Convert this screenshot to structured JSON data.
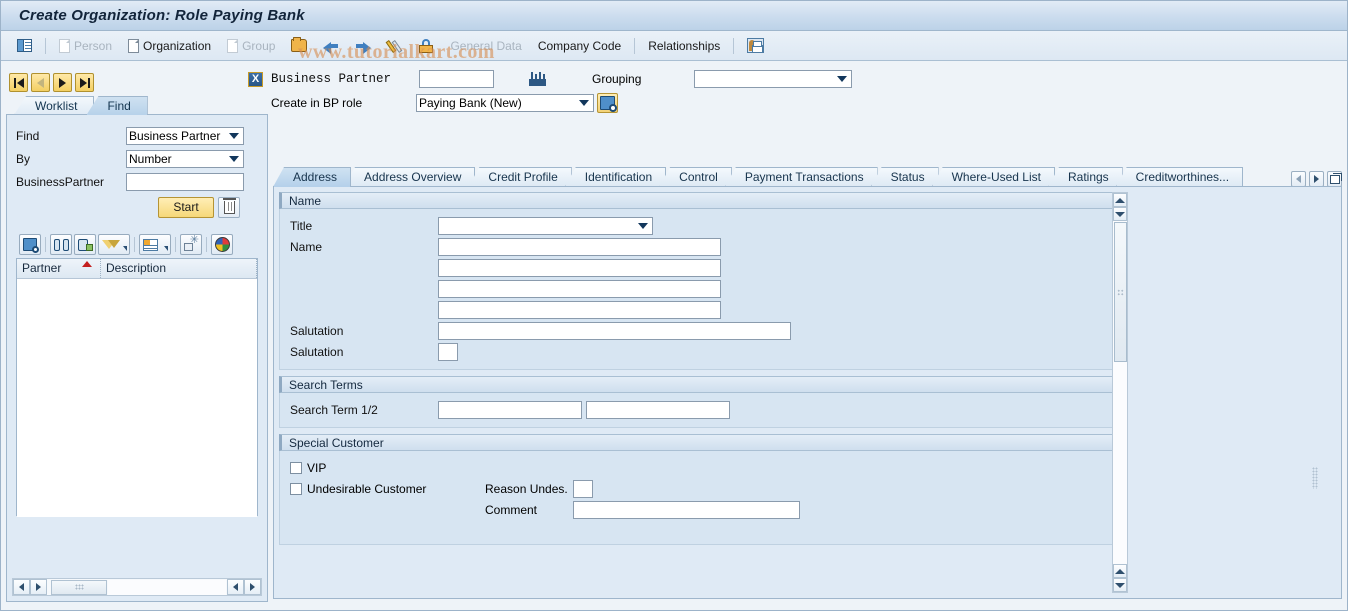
{
  "window": {
    "title": "Create Organization: Role Paying Bank"
  },
  "watermark": {
    "text": "www.tutorialkart.com",
    "ring_glyph": "c"
  },
  "toolbar": {
    "items": [
      {
        "name": "worklist-toggle",
        "label": "",
        "icon": "list-icon",
        "enabled": true
      },
      {
        "name": "person",
        "label": "Person",
        "icon": "page-icon",
        "enabled": false
      },
      {
        "name": "organization",
        "label": "Organization",
        "icon": "page-icon",
        "enabled": true
      },
      {
        "name": "group",
        "label": "Group",
        "icon": "page-icon",
        "enabled": false
      },
      {
        "name": "open-folder",
        "label": "",
        "icon": "open-folder-icon",
        "enabled": true
      },
      {
        "name": "back",
        "label": "",
        "icon": "arrow-left-icon",
        "enabled": true
      },
      {
        "name": "forward",
        "label": "",
        "icon": "arrow-right-icon",
        "enabled": true
      },
      {
        "name": "change",
        "label": "",
        "icon": "pencil-icon",
        "enabled": true
      },
      {
        "name": "display",
        "label": "",
        "icon": "lock-icon",
        "enabled": true
      },
      {
        "name": "general-data",
        "label": "General Data",
        "enabled": false
      },
      {
        "name": "company-code",
        "label": "Company Code",
        "enabled": true
      },
      {
        "name": "relationships",
        "label": "Relationships",
        "enabled": true
      },
      {
        "name": "relationship-bp",
        "label": "",
        "icon": "relationship-bp-icon",
        "enabled": true
      }
    ]
  },
  "navigation": {
    "first_label": "First",
    "prev_label": "Previous",
    "next_label": "Next",
    "last_label": "Last"
  },
  "left_panel": {
    "tabs": [
      {
        "label": "Worklist",
        "active": false
      },
      {
        "label": "Find",
        "active": true
      }
    ],
    "find": {
      "find_label": "Find",
      "find_value": "Business Partner",
      "by_label": "By",
      "by_value": "Number",
      "partner_label": "BusinessPartner",
      "partner_value": "",
      "start_label": "Start",
      "delete_label": "Delete"
    },
    "alv_toolbar": [
      {
        "name": "detail",
        "icon": "magnifier-icon"
      },
      {
        "name": "find",
        "icon": "binoculars-icon"
      },
      {
        "name": "find-next",
        "icon": "binoculars-next-icon"
      },
      {
        "name": "filter",
        "icon": "funnel-icon",
        "dropdown": true
      },
      {
        "name": "layout",
        "icon": "grid-icon",
        "dropdown": true
      },
      {
        "name": "select-layout",
        "icon": "layout-star-icon"
      },
      {
        "name": "color-settings",
        "icon": "color-wheel-icon"
      }
    ],
    "table": {
      "columns": [
        {
          "label": "Partner",
          "sort": "ascending"
        },
        {
          "label": "Description",
          "sort": null
        }
      ],
      "rows": []
    }
  },
  "header_form": {
    "close_label": "X",
    "business_partner_label": "Business Partner",
    "business_partner_value": "",
    "bp_search_icon": "factory-icon",
    "grouping_label": "Grouping",
    "grouping_value": "",
    "create_role_label": "Create in BP role",
    "create_role_value": "Paying Bank (New)",
    "role_search_icon": "magnifier-icon"
  },
  "tabstrip": {
    "tabs": [
      {
        "label": "Address",
        "active": true
      },
      {
        "label": "Address Overview",
        "active": false
      },
      {
        "label": "Credit Profile",
        "active": false
      },
      {
        "label": "Identification",
        "active": false
      },
      {
        "label": "Control",
        "active": false
      },
      {
        "label": "Payment Transactions",
        "active": false
      },
      {
        "label": "Status",
        "active": false
      },
      {
        "label": "Where-Used List",
        "active": false
      },
      {
        "label": "Ratings",
        "active": false
      },
      {
        "label": "Creditworthines...",
        "active": false
      }
    ],
    "nav": {
      "prev_label": "Previous Tab",
      "next_label": "Next Tab",
      "overview_label": "Tab Overview"
    }
  },
  "address_tab": {
    "name_group": {
      "title": "Name",
      "title_label": "Title",
      "title_value": "",
      "name_label": "Name",
      "name_line1": "",
      "name_line2": "",
      "name_line3": "",
      "name_line4": "",
      "salutation_label": "Salutation",
      "salutation_value": "",
      "salutation_key_label": "Salutation",
      "salutation_key_value": ""
    },
    "search_terms_group": {
      "title": "Search Terms",
      "search_term_label": "Search Term 1/2",
      "search_term_1": "",
      "search_term_2": ""
    },
    "special_customer_group": {
      "title": "Special Customer",
      "vip_label": "VIP",
      "vip_checked": false,
      "undesirable_label": "Undesirable Customer",
      "undesirable_checked": false,
      "reason_label": "Reason Undes.",
      "reason_value": "",
      "comment_label": "Comment",
      "comment_value": ""
    }
  },
  "theme": {
    "title_bar": "#cbdcee",
    "accent_gold": "#f3cf63",
    "panel_bg": "#dfeaf5",
    "group_bg": "#d7e5f2",
    "border": "#9fb6cc",
    "sort_marker": "#c31f1f"
  }
}
